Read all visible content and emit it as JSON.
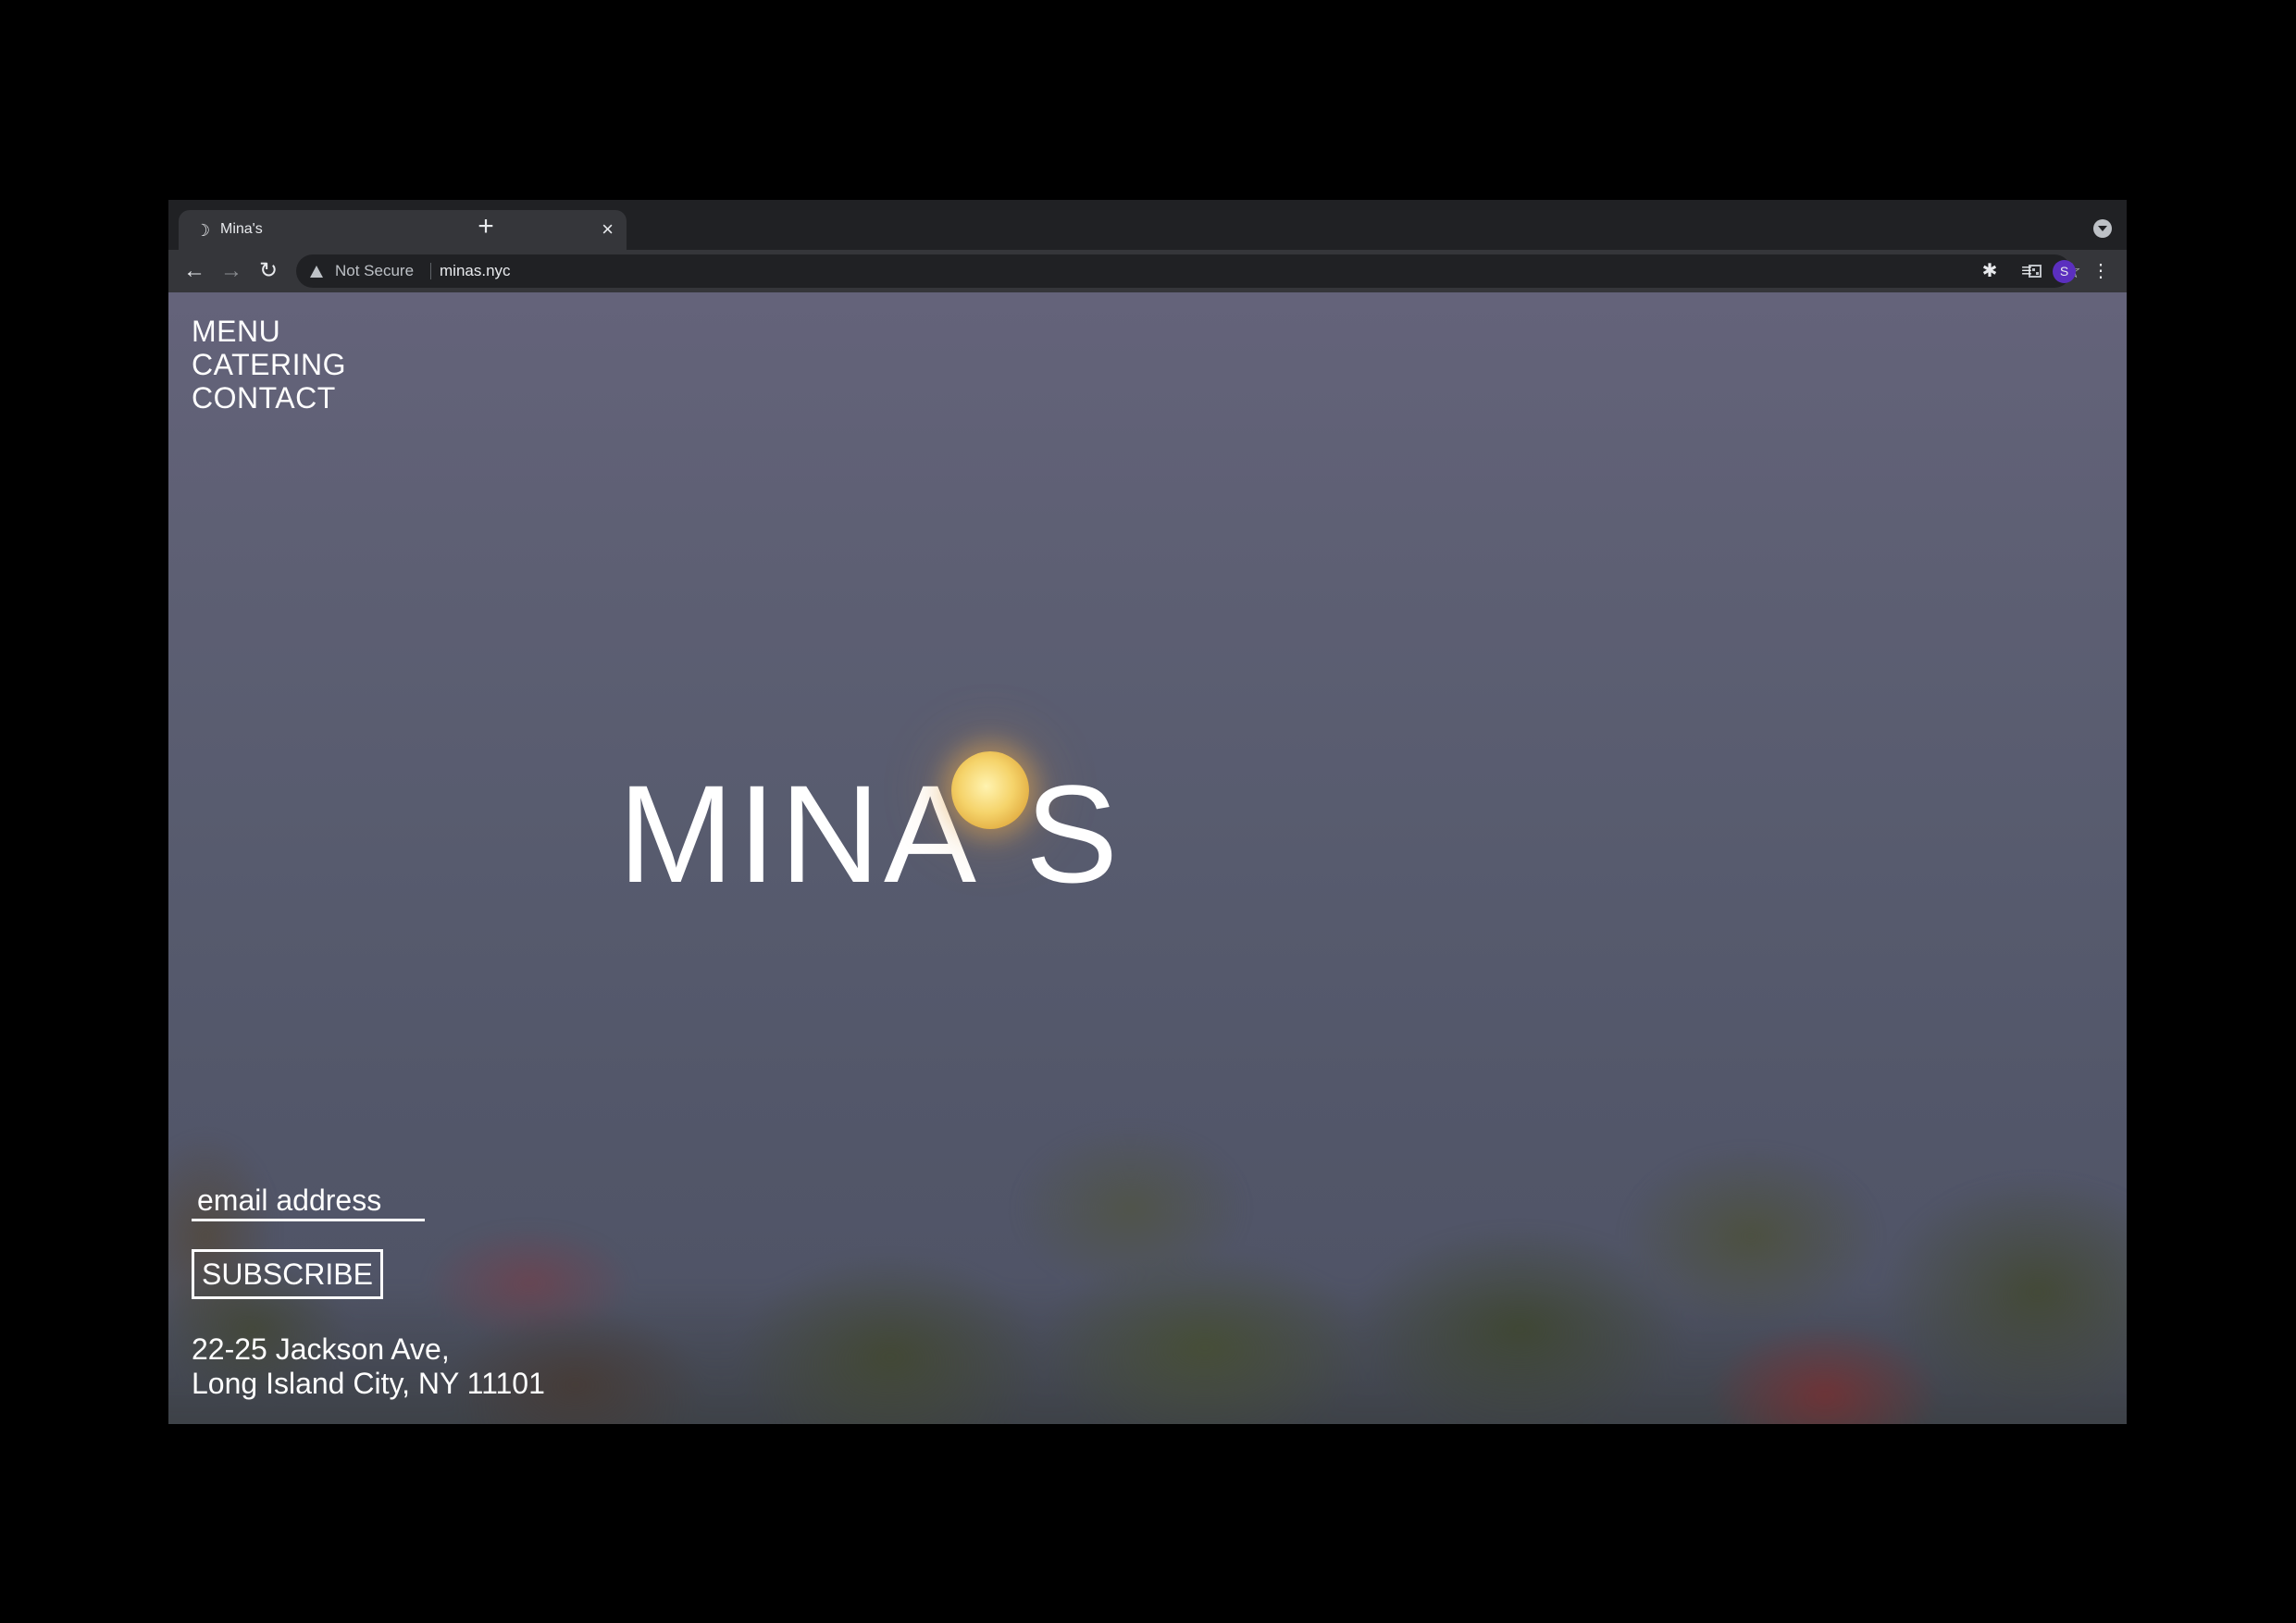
{
  "browser": {
    "tab_title": "Mina's",
    "new_tab_symbol": "+",
    "close_symbol": "×",
    "security_label": "Not Secure",
    "url": "minas.nyc",
    "avatar_initial": "S",
    "icons": [
      "moon-favicon-icon",
      "back-arrow-icon",
      "forward-arrow-icon",
      "reload-icon",
      "warning-icon",
      "qr-code-icon",
      "bookmark-star-icon",
      "extensions-puzzle-icon",
      "reading-list-icon",
      "profile-avatar",
      "kebab-menu-icon",
      "tab-search-icon"
    ]
  },
  "site": {
    "nav": [
      "MENU",
      "CATERING",
      "CONTACT"
    ],
    "logo_left": "MINA",
    "logo_right": "S",
    "email_placeholder": "email address",
    "subscribe_label": "SUBSCRIBE",
    "address_line1": "22-25 Jackson Ave,",
    "address_line2": "Long Island City, NY 11101"
  },
  "colors": {
    "sky": "#5a5d70",
    "text": "#ffffff",
    "moon": "#f5d36a",
    "browser_chrome": "#35363a",
    "avatar": "#5b2fbf"
  }
}
